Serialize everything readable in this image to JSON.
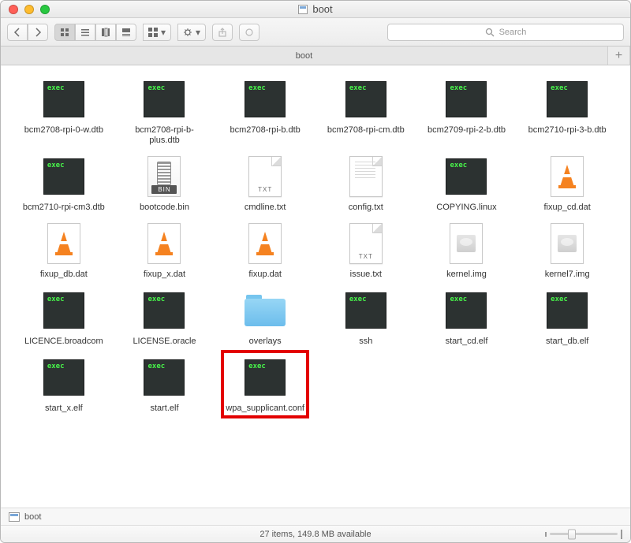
{
  "window": {
    "title": "boot"
  },
  "tabs": {
    "active": "boot",
    "plus": "+"
  },
  "search": {
    "placeholder": "Search"
  },
  "pathbar": {
    "segment": "boot"
  },
  "statusbar": {
    "text": "27 items, 149.8 MB available"
  },
  "files": [
    {
      "name": "bcm2708-rpi-0-w.dtb",
      "kind": "exec"
    },
    {
      "name": "bcm2708-rpi-b-plus.dtb",
      "kind": "exec"
    },
    {
      "name": "bcm2708-rpi-b.dtb",
      "kind": "exec"
    },
    {
      "name": "bcm2708-rpi-cm.dtb",
      "kind": "exec"
    },
    {
      "name": "bcm2709-rpi-2-b.dtb",
      "kind": "exec"
    },
    {
      "name": "bcm2710-rpi-3-b.dtb",
      "kind": "exec"
    },
    {
      "name": "bcm2710-rpi-cm3.dtb",
      "kind": "exec"
    },
    {
      "name": "bootcode.bin",
      "kind": "bin",
      "tag": "BIN"
    },
    {
      "name": "cmdline.txt",
      "kind": "txt",
      "tag": "TXT"
    },
    {
      "name": "config.txt",
      "kind": "txtlines"
    },
    {
      "name": "COPYING.linux",
      "kind": "exec"
    },
    {
      "name": "fixup_cd.dat",
      "kind": "cone"
    },
    {
      "name": "fixup_db.dat",
      "kind": "cone"
    },
    {
      "name": "fixup_x.dat",
      "kind": "cone"
    },
    {
      "name": "fixup.dat",
      "kind": "cone"
    },
    {
      "name": "issue.txt",
      "kind": "txt",
      "tag": "TXT"
    },
    {
      "name": "kernel.img",
      "kind": "img"
    },
    {
      "name": "kernel7.img",
      "kind": "img"
    },
    {
      "name": "LICENCE.broadcom",
      "kind": "exec"
    },
    {
      "name": "LICENSE.oracle",
      "kind": "exec"
    },
    {
      "name": "overlays",
      "kind": "folder"
    },
    {
      "name": "ssh",
      "kind": "exec"
    },
    {
      "name": "start_cd.elf",
      "kind": "exec"
    },
    {
      "name": "start_db.elf",
      "kind": "exec"
    },
    {
      "name": "start_x.elf",
      "kind": "exec"
    },
    {
      "name": "start.elf",
      "kind": "exec"
    },
    {
      "name": "wpa_supplicant.conf",
      "kind": "exec",
      "highlight": true
    }
  ]
}
